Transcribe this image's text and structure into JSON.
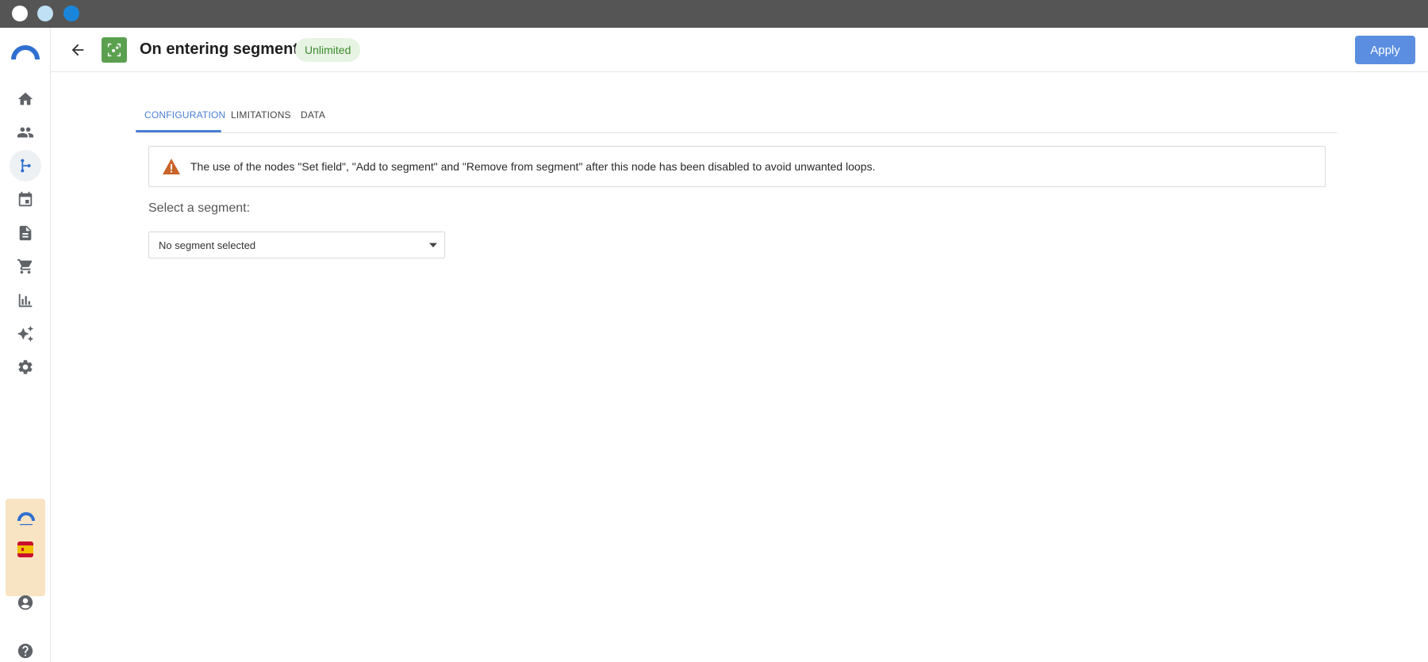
{
  "window": {
    "controls": [
      "close",
      "minimize",
      "maximize"
    ]
  },
  "sidebar": {
    "logo": "brand-arc-logo",
    "items": [
      {
        "id": "home",
        "icon": "home-icon"
      },
      {
        "id": "contacts",
        "icon": "people-icon"
      },
      {
        "id": "workflows",
        "icon": "branch-icon",
        "active": true
      },
      {
        "id": "calendar",
        "icon": "calendar-icon"
      },
      {
        "id": "documents",
        "icon": "document-icon"
      },
      {
        "id": "shop",
        "icon": "cart-icon"
      },
      {
        "id": "statistics",
        "icon": "bar-chart-icon"
      },
      {
        "id": "ai",
        "icon": "sparkle-icon"
      },
      {
        "id": "settings",
        "icon": "gear-icon"
      }
    ],
    "bottom": {
      "promo_logo": "brand-arc-logo",
      "language_flag": "spain-flag-icon",
      "account": "account-circle-icon",
      "help": "help-circle-icon"
    }
  },
  "header": {
    "back_icon": "arrow-left-icon",
    "node_icon": "segment-target-icon",
    "title": "On entering segment",
    "badge": "Unlimited",
    "apply_label": "Apply"
  },
  "tabs": [
    {
      "label": "CONFIGURATION",
      "active": true
    },
    {
      "label": "LIMITATIONS",
      "active": false
    },
    {
      "label": "DATA",
      "active": false
    }
  ],
  "warning": {
    "icon": "warning-triangle-icon",
    "text": "The use of the nodes \"Set field\", \"Add to segment\" and \"Remove from segment\" after this node has been disabled to avoid unwanted loops."
  },
  "segment": {
    "label": "Select a segment:",
    "selected_value": "No segment selected"
  },
  "colors": {
    "accent": "#5b8ee0",
    "tab_active": "#4a7ed6",
    "node_green": "#5aa04f",
    "badge_bg": "#e7f3e3",
    "badge_text": "#3d8a2f",
    "warning_orange": "#c9642a",
    "titlebar": "#555555"
  }
}
